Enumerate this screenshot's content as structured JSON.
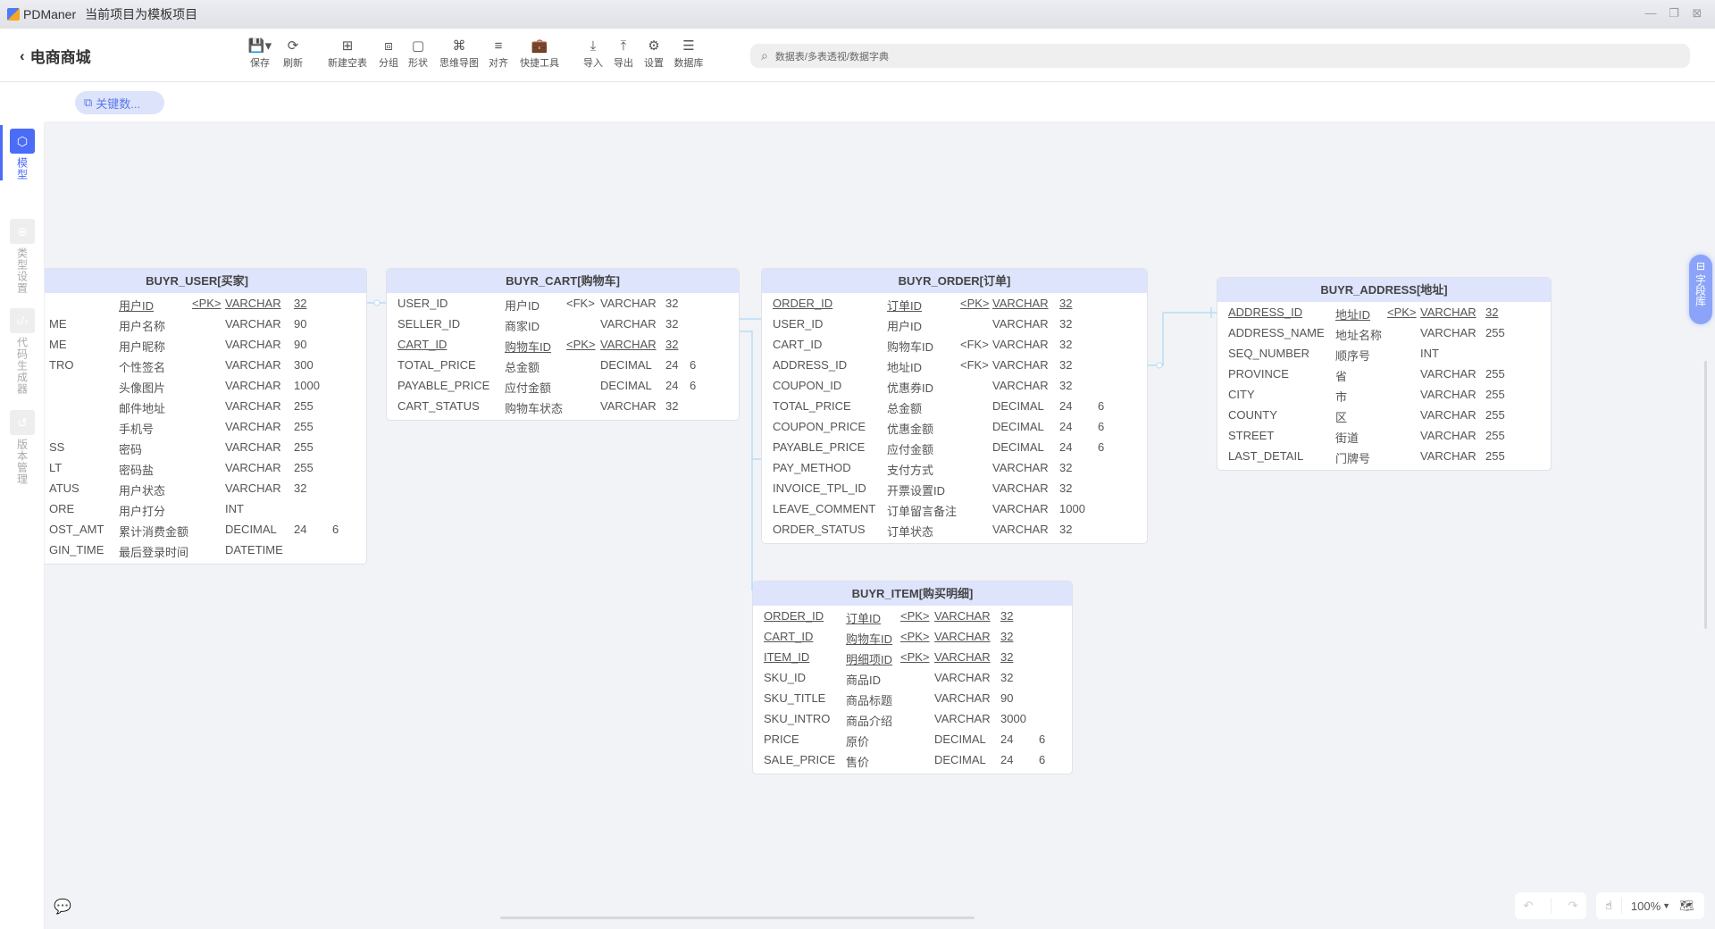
{
  "app": {
    "name": "PDManer",
    "project_note": "当前项目为模板项目"
  },
  "toolbar": {
    "back_title": "电商商城",
    "tools": [
      {
        "label": "保存",
        "icon": "save-icon",
        "glyph": "💾▾"
      },
      {
        "label": "刷新",
        "icon": "refresh-icon",
        "glyph": "⟳"
      },
      {
        "label": "新建空表",
        "icon": "new-table-icon",
        "glyph": "⊞"
      },
      {
        "label": "分组",
        "icon": "group-icon",
        "glyph": "⧈"
      },
      {
        "label": "形状",
        "icon": "shape-icon",
        "glyph": "▢"
      },
      {
        "label": "思维导图",
        "icon": "mindmap-icon",
        "glyph": "⌘"
      },
      {
        "label": "对齐",
        "icon": "align-icon",
        "glyph": "≡"
      },
      {
        "label": "快捷工具",
        "icon": "toolbox-icon",
        "glyph": "💼"
      },
      {
        "label": "导入",
        "icon": "import-icon",
        "glyph": "⤓"
      },
      {
        "label": "导出",
        "icon": "export-icon",
        "glyph": "⤒"
      },
      {
        "label": "设置",
        "icon": "gear-icon",
        "glyph": "⚙"
      },
      {
        "label": "数据库",
        "icon": "database-icon",
        "glyph": "☰"
      }
    ],
    "search_placeholder": "数据表/多表透视/数据字典"
  },
  "subbar": {
    "pill_label": "关键数..."
  },
  "sidebar": {
    "items": [
      {
        "label": "模型",
        "icon": "cube-icon",
        "active": true
      },
      {
        "label": "类型设置",
        "icon": "globe-icon",
        "active": false
      },
      {
        "label": "代码生成器",
        "icon": "code-icon",
        "active": false
      },
      {
        "label": "版本管理",
        "icon": "history-icon",
        "active": false
      }
    ]
  },
  "field_library": {
    "label": "字段库"
  },
  "zoom": {
    "level": "100%"
  },
  "colors": {
    "accent": "#4a6cf7",
    "table_header": "#dde4fc",
    "link": "#b9dcf7"
  },
  "tables": [
    {
      "title": "BUYR_USER[买家]",
      "rows": [
        {
          "name": "",
          "code": "用户ID",
          "key": "<PK>",
          "type": "VARCHAR",
          "len": "32",
          "scale": "",
          "pk": true
        },
        {
          "name": "ME",
          "code": "用户名称",
          "key": "",
          "type": "VARCHAR",
          "len": "90",
          "scale": ""
        },
        {
          "name": "ME",
          "code": "用户昵称",
          "key": "",
          "type": "VARCHAR",
          "len": "90",
          "scale": ""
        },
        {
          "name": "TRO",
          "code": "个性签名",
          "key": "",
          "type": "VARCHAR",
          "len": "300",
          "scale": ""
        },
        {
          "name": "",
          "code": "头像图片",
          "key": "",
          "type": "VARCHAR",
          "len": "1000",
          "scale": ""
        },
        {
          "name": "",
          "code": "邮件地址",
          "key": "",
          "type": "VARCHAR",
          "len": "255",
          "scale": ""
        },
        {
          "name": "",
          "code": "手机号",
          "key": "",
          "type": "VARCHAR",
          "len": "255",
          "scale": ""
        },
        {
          "name": "SS",
          "code": "密码",
          "key": "",
          "type": "VARCHAR",
          "len": "255",
          "scale": ""
        },
        {
          "name": "LT",
          "code": "密码盐",
          "key": "",
          "type": "VARCHAR",
          "len": "255",
          "scale": ""
        },
        {
          "name": "ATUS",
          "code": "用户状态",
          "key": "",
          "type": "VARCHAR",
          "len": "32",
          "scale": ""
        },
        {
          "name": "ORE",
          "code": "用户打分",
          "key": "",
          "type": "INT",
          "len": "",
          "scale": ""
        },
        {
          "name": "OST_AMT",
          "code": "累计消费金额",
          "key": "",
          "type": "DECIMAL",
          "len": "24",
          "scale": "6"
        },
        {
          "name": "GIN_TIME",
          "code": "最后登录时间",
          "key": "",
          "type": "DATETIME",
          "len": "",
          "scale": ""
        }
      ]
    },
    {
      "title": "BUYR_CART[购物车]",
      "rows": [
        {
          "name": "USER_ID",
          "code": "用户ID",
          "key": "<FK>",
          "type": "VARCHAR",
          "len": "32",
          "scale": ""
        },
        {
          "name": "SELLER_ID",
          "code": "商家ID",
          "key": "",
          "type": "VARCHAR",
          "len": "32",
          "scale": ""
        },
        {
          "name": "CART_ID",
          "code": "购物车ID",
          "key": "<PK>",
          "type": "VARCHAR",
          "len": "32",
          "scale": "",
          "pk": true
        },
        {
          "name": "TOTAL_PRICE",
          "code": "总金额",
          "key": "",
          "type": "DECIMAL",
          "len": "24",
          "scale": "6"
        },
        {
          "name": "PAYABLE_PRICE",
          "code": "应付金额",
          "key": "",
          "type": "DECIMAL",
          "len": "24",
          "scale": "6"
        },
        {
          "name": "CART_STATUS",
          "code": "购物车状态",
          "key": "",
          "type": "VARCHAR",
          "len": "32",
          "scale": ""
        }
      ]
    },
    {
      "title": "BUYR_ORDER[订单]",
      "rows": [
        {
          "name": "ORDER_ID",
          "code": "订单ID",
          "key": "<PK>",
          "type": "VARCHAR",
          "len": "32",
          "scale": "",
          "pk": true
        },
        {
          "name": "USER_ID",
          "code": "用户ID",
          "key": "",
          "type": "VARCHAR",
          "len": "32",
          "scale": ""
        },
        {
          "name": "CART_ID",
          "code": "购物车ID",
          "key": "<FK>",
          "type": "VARCHAR",
          "len": "32",
          "scale": ""
        },
        {
          "name": "ADDRESS_ID",
          "code": "地址ID",
          "key": "<FK>",
          "type": "VARCHAR",
          "len": "32",
          "scale": ""
        },
        {
          "name": "COUPON_ID",
          "code": "优惠券ID",
          "key": "",
          "type": "VARCHAR",
          "len": "32",
          "scale": ""
        },
        {
          "name": "TOTAL_PRICE",
          "code": "总金额",
          "key": "",
          "type": "DECIMAL",
          "len": "24",
          "scale": "6"
        },
        {
          "name": "COUPON_PRICE",
          "code": "优惠金额",
          "key": "",
          "type": "DECIMAL",
          "len": "24",
          "scale": "6"
        },
        {
          "name": "PAYABLE_PRICE",
          "code": "应付金额",
          "key": "",
          "type": "DECIMAL",
          "len": "24",
          "scale": "6"
        },
        {
          "name": "PAY_METHOD",
          "code": "支付方式",
          "key": "",
          "type": "VARCHAR",
          "len": "32",
          "scale": ""
        },
        {
          "name": "INVOICE_TPL_ID",
          "code": "开票设置ID",
          "key": "",
          "type": "VARCHAR",
          "len": "32",
          "scale": ""
        },
        {
          "name": "LEAVE_COMMENT",
          "code": "订单留言备注",
          "key": "",
          "type": "VARCHAR",
          "len": "1000",
          "scale": ""
        },
        {
          "name": "ORDER_STATUS",
          "code": "订单状态",
          "key": "",
          "type": "VARCHAR",
          "len": "32",
          "scale": ""
        }
      ]
    },
    {
      "title": "BUYR_ADDRESS[地址]",
      "rows": [
        {
          "name": "ADDRESS_ID",
          "code": "地址ID",
          "key": "<PK>",
          "type": "VARCHAR",
          "len": "32",
          "scale": "",
          "pk": true
        },
        {
          "name": "ADDRESS_NAME",
          "code": "地址名称",
          "key": "",
          "type": "VARCHAR",
          "len": "255",
          "scale": ""
        },
        {
          "name": "SEQ_NUMBER",
          "code": "顺序号",
          "key": "",
          "type": "INT",
          "len": "",
          "scale": ""
        },
        {
          "name": "PROVINCE",
          "code": "省",
          "key": "",
          "type": "VARCHAR",
          "len": "255",
          "scale": ""
        },
        {
          "name": "CITY",
          "code": "市",
          "key": "",
          "type": "VARCHAR",
          "len": "255",
          "scale": ""
        },
        {
          "name": "COUNTY",
          "code": "区",
          "key": "",
          "type": "VARCHAR",
          "len": "255",
          "scale": ""
        },
        {
          "name": "STREET",
          "code": "街道",
          "key": "",
          "type": "VARCHAR",
          "len": "255",
          "scale": ""
        },
        {
          "name": "LAST_DETAIL",
          "code": "门牌号",
          "key": "",
          "type": "VARCHAR",
          "len": "255",
          "scale": ""
        }
      ]
    },
    {
      "title": "BUYR_ITEM[购买明细]",
      "rows": [
        {
          "name": "ORDER_ID",
          "code": "订单ID",
          "key": "<PK>",
          "type": "VARCHAR",
          "len": "32",
          "scale": "",
          "pk": true
        },
        {
          "name": "CART_ID",
          "code": "购物车ID",
          "key": "<PK>",
          "type": "VARCHAR",
          "len": "32",
          "scale": "",
          "pk": true
        },
        {
          "name": "ITEM_ID",
          "code": "明细项ID",
          "key": "<PK>",
          "type": "VARCHAR",
          "len": "32",
          "scale": "",
          "pk": true
        },
        {
          "name": "SKU_ID",
          "code": "商品ID",
          "key": "",
          "type": "VARCHAR",
          "len": "32",
          "scale": ""
        },
        {
          "name": "SKU_TITLE",
          "code": "商品标题",
          "key": "",
          "type": "VARCHAR",
          "len": "90",
          "scale": ""
        },
        {
          "name": "SKU_INTRO",
          "code": "商品介绍",
          "key": "",
          "type": "VARCHAR",
          "len": "3000",
          "scale": ""
        },
        {
          "name": "PRICE",
          "code": "原价",
          "key": "",
          "type": "DECIMAL",
          "len": "24",
          "scale": "6"
        },
        {
          "name": "SALE_PRICE",
          "code": "售价",
          "key": "",
          "type": "DECIMAL",
          "len": "24",
          "scale": "6"
        }
      ]
    }
  ]
}
